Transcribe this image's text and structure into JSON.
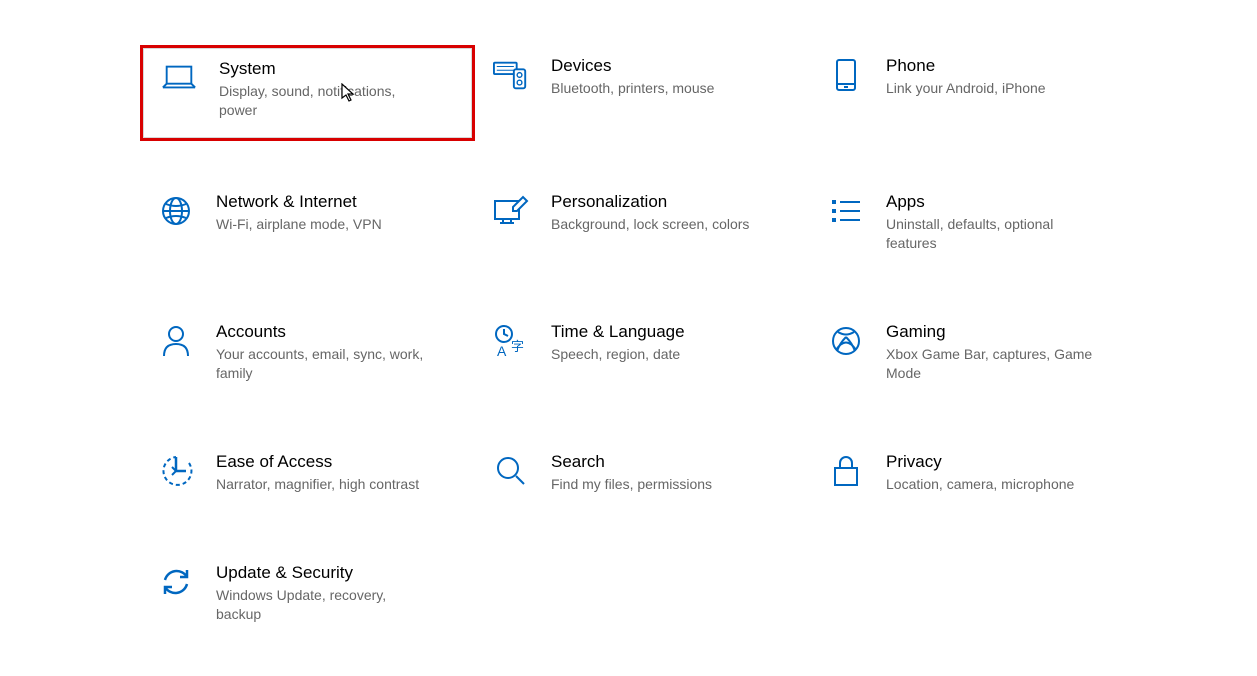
{
  "colors": {
    "icon": "#0067c0",
    "highlight_border": "#d80000"
  },
  "categories": {
    "system": {
      "title": "System",
      "desc": "Display, sound, notifications, power"
    },
    "devices": {
      "title": "Devices",
      "desc": "Bluetooth, printers, mouse"
    },
    "phone": {
      "title": "Phone",
      "desc": "Link your Android, iPhone"
    },
    "network": {
      "title": "Network & Internet",
      "desc": "Wi-Fi, airplane mode, VPN"
    },
    "personalization": {
      "title": "Personalization",
      "desc": "Background, lock screen, colors"
    },
    "apps": {
      "title": "Apps",
      "desc": "Uninstall, defaults, optional features"
    },
    "accounts": {
      "title": "Accounts",
      "desc": "Your accounts, email, sync, work, family"
    },
    "time_language": {
      "title": "Time & Language",
      "desc": "Speech, region, date"
    },
    "gaming": {
      "title": "Gaming",
      "desc": "Xbox Game Bar, captures, Game Mode"
    },
    "ease_of_access": {
      "title": "Ease of Access",
      "desc": "Narrator, magnifier, high contrast"
    },
    "search": {
      "title": "Search",
      "desc": "Find my files, permissions"
    },
    "privacy": {
      "title": "Privacy",
      "desc": "Location, camera, microphone"
    },
    "update_security": {
      "title": "Update & Security",
      "desc": "Windows Update, recovery, backup"
    }
  }
}
